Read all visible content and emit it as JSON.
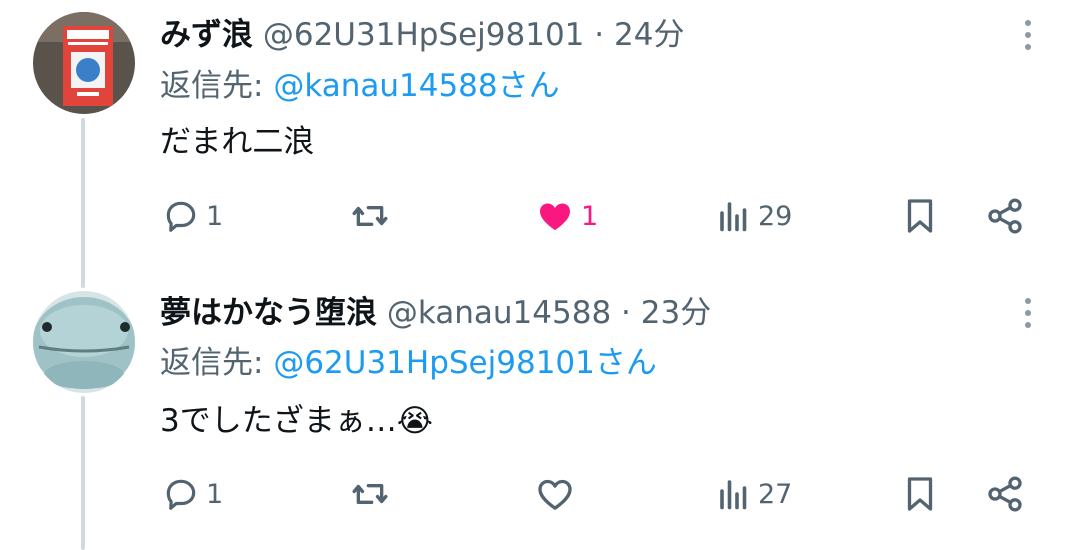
{
  "tweets": [
    {
      "display_name": "みず浪",
      "handle": "@62U31HpSej98101",
      "separator": "·",
      "time": "24分",
      "reply_prefix": "返信先: ",
      "reply_to": "@kanau14588",
      "reply_suffix": "さん",
      "text": "だまれ二浪",
      "replies": "1",
      "retweets": "",
      "likes": "1",
      "liked": true,
      "views": "29",
      "avatar": "book-cover-avatar"
    },
    {
      "display_name": "夢はかなう堕浪",
      "handle": "@kanau14588",
      "separator": "·",
      "time": "23分",
      "reply_prefix": "返信先: ",
      "reply_to": "@62U31HpSej98101",
      "reply_suffix": "さん",
      "text": "3でしたざまぁ…",
      "emoji": "😭",
      "replies": "1",
      "retweets": "",
      "likes": "",
      "liked": false,
      "views": "27",
      "avatar": "blue-plush-avatar"
    }
  ],
  "colors": {
    "text": "#0f1419",
    "secondary": "#536471",
    "link": "#1d9bf0",
    "like": "#f91880",
    "thread_line": "#cfd9de"
  },
  "icons": [
    "reply-icon",
    "retweet-icon",
    "heart-icon",
    "views-icon",
    "bookmark-icon",
    "share-icon",
    "more-icon"
  ]
}
